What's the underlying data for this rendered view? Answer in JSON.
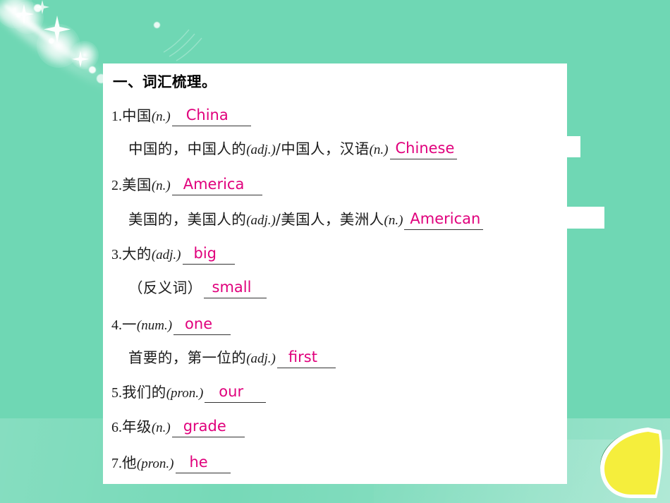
{
  "slide": {
    "background_color": "#6FD7B4",
    "card_color": "#FFFFFF",
    "answer_color": "#E0007C",
    "accent_leaf_color": "#F5EE3C"
  },
  "heading": "一、词汇梳理。",
  "items": [
    {
      "number": "1.",
      "lines": [
        {
          "prompt_cn": "中国",
          "pos": "(n.)",
          "answer": "China"
        },
        {
          "prompt_cn": "中国的，中国人的",
          "pos": "(adj.)",
          "separator": "/",
          "prompt_cn2": "中国人，汉语",
          "pos2": "(n.)",
          "answer": "Chinese"
        }
      ]
    },
    {
      "number": "2.",
      "lines": [
        {
          "prompt_cn": "美国",
          "pos": "(n.)",
          "answer": "America"
        },
        {
          "prompt_cn": "美国的，美国人的",
          "pos": "(adj.)",
          "separator": "/",
          "prompt_cn2": "美国人，美洲人",
          "pos2": "(n.)",
          "answer": "American"
        }
      ]
    },
    {
      "number": "3.",
      "lines": [
        {
          "prompt_cn": "大的",
          "pos": "(adj.)",
          "answer": "big"
        },
        {
          "prompt_cn": "（反义词）",
          "pos": "",
          "answer": "small"
        }
      ]
    },
    {
      "number": "4.",
      "lines": [
        {
          "prompt_cn": "一",
          "pos": "(num.)",
          "answer": "one"
        },
        {
          "prompt_cn": "首要的，第一位的",
          "pos": "(adj.)",
          "answer": "first"
        }
      ]
    },
    {
      "number": "5.",
      "lines": [
        {
          "prompt_cn": "我们的",
          "pos": "(pron.)",
          "answer": "our"
        }
      ]
    },
    {
      "number": "6.",
      "lines": [
        {
          "prompt_cn": "年级",
          "pos": "(n.)",
          "answer": "grade"
        }
      ]
    },
    {
      "number": "7.",
      "lines": [
        {
          "prompt_cn": "他",
          "pos": "(pron.)",
          "answer": "he"
        }
      ]
    }
  ],
  "rows": {
    "r_head": "一、词汇梳理。",
    "r1a_num": "1.",
    "r1a_cn": "中国",
    "r1a_pos": "(n.)",
    "r1a_ans": "China",
    "r1b_cn": "中国的，中国人的",
    "r1b_pos": "(adj.)",
    "r1b_sep": "/",
    "r1b_cn2": "中国人，汉语",
    "r1b_pos2": "(n.)",
    "r1b_ans": "Chinese",
    "r2a_num": "2.",
    "r2a_cn": "美国",
    "r2a_pos": "(n.)",
    "r2a_ans": "America",
    "r2b_cn": "美国的，美国人的",
    "r2b_pos": "(adj.)",
    "r2b_sep": "/",
    "r2b_cn2": "美国人，美洲人",
    "r2b_pos2": "(n.)",
    "r2b_ans": "American",
    "r3a_num": "3.",
    "r3a_cn": "大的",
    "r3a_pos": "(adj.)",
    "r3a_ans": "big",
    "r3b_cn": "（反义词）",
    "r3b_ans": "small",
    "r4a_num": "4.",
    "r4a_cn": "一",
    "r4a_pos": "(num.)",
    "r4a_ans": "one",
    "r4b_cn": "首要的，第一位的",
    "r4b_pos": "(adj.)",
    "r4b_ans": "first",
    "r5_num": "5.",
    "r5_cn": "我们的",
    "r5_pos": "(pron.)",
    "r5_ans": "our",
    "r6_num": "6.",
    "r6_cn": "年级",
    "r6_pos": "(n.)",
    "r6_ans": "grade",
    "r7_num": "7.",
    "r7_cn": "他",
    "r7_pos": "(pron.)",
    "r7_ans": "he"
  }
}
